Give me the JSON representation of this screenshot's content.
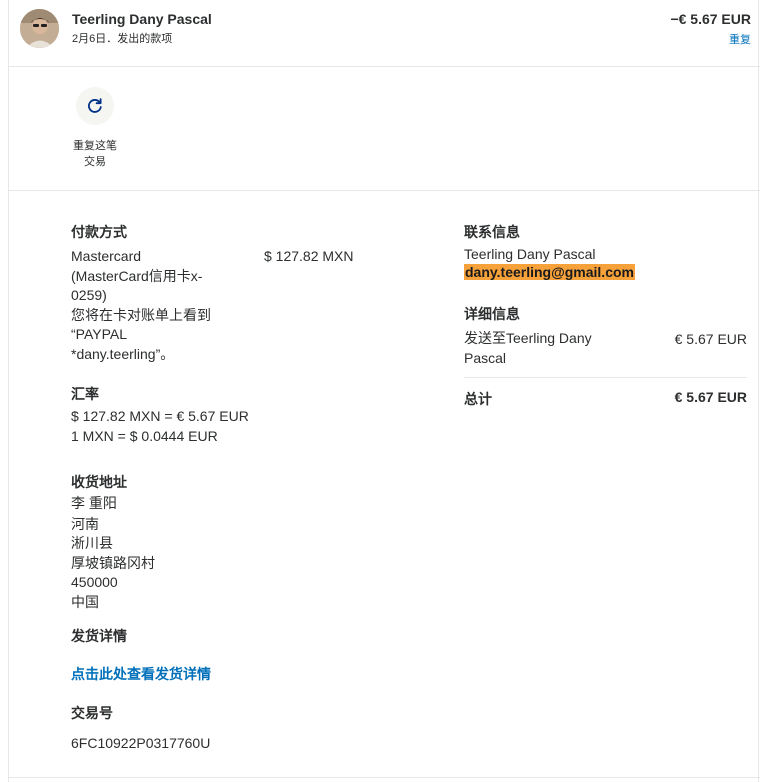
{
  "header": {
    "name": "Teerling Dany Pascal",
    "subtitle": "2月6日．发出的款项",
    "amount": "−€ 5.67 EUR",
    "repeat_link": "重复"
  },
  "actions": {
    "repeat_label_line1": "重复这笔",
    "repeat_label_line2": "交易"
  },
  "payment": {
    "heading": "付款方式",
    "lines": [
      "Mastercard",
      "(MasterCard信用卡x-",
      "0259)",
      "您将在卡对账单上看到",
      "“PAYPAL",
      "*dany.teerling”。"
    ],
    "amount": "$ 127.82 MXN"
  },
  "exchange": {
    "heading": "汇率",
    "line1": "$ 127.82 MXN = € 5.67 EUR",
    "line2": "1 MXN = $ 0.0444 EUR"
  },
  "shipping": {
    "heading": "收货地址",
    "lines": [
      "李 重阳",
      "河南",
      "淅川县",
      "厚坡镇路冈村",
      "450000",
      "中国"
    ]
  },
  "shipping_details": {
    "heading": "发货详情",
    "link": "点击此处查看发货详情"
  },
  "transaction": {
    "heading": "交易号",
    "id": "6FC10922P0317760U"
  },
  "contact": {
    "heading": "联系信息",
    "name": "Teerling Dany Pascal",
    "email": "dany.teerling@gmail.com"
  },
  "detail_info": {
    "heading": "详细信息",
    "sent_to_line1": "发送至Teerling Dany",
    "sent_to_line2": "Pascal",
    "amount": "€ 5.67 EUR"
  },
  "total": {
    "label": "总计",
    "amount": "€ 5.67 EUR"
  },
  "colors": {
    "link": "#0070ba",
    "email_highlight": "#f7a13a",
    "text": "#2c2e2f",
    "border": "#e6e7e8"
  },
  "icons": {
    "avatar": "user-avatar",
    "repeat": "refresh-icon"
  }
}
